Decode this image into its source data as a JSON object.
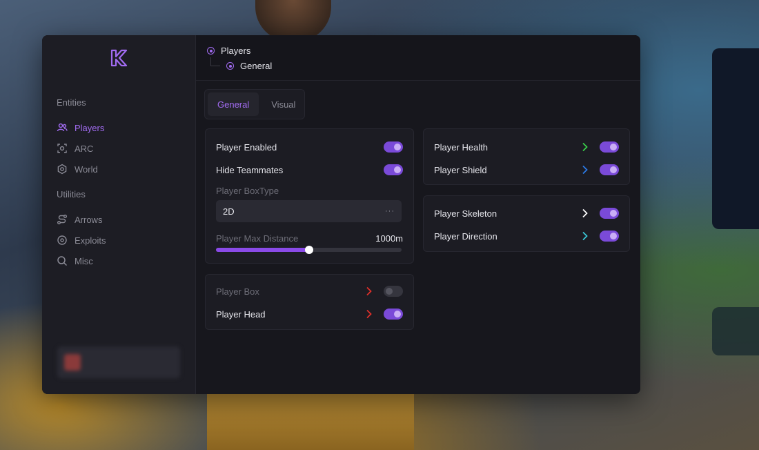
{
  "sidebar": {
    "sections": {
      "entities": "Entities",
      "utilities": "Utilities"
    },
    "items": [
      {
        "label": "Players",
        "icon": "users-icon"
      },
      {
        "label": "ARC",
        "icon": "target-icon"
      },
      {
        "label": "World",
        "icon": "gear-icon"
      },
      {
        "label": "Arrows",
        "icon": "route-icon"
      },
      {
        "label": "Exploits",
        "icon": "crosshair-icon"
      },
      {
        "label": "Misc",
        "icon": "search-icon"
      }
    ],
    "active_item": "Players"
  },
  "breadcrumb": {
    "level1": "Players",
    "level2": "General"
  },
  "tabs": {
    "general": "General",
    "visual": "Visual",
    "active": "General"
  },
  "general_card": {
    "player_enabled": "Player Enabled",
    "hide_teammates": "Hide Teammates",
    "boxtype_label": "Player BoxType",
    "boxtype_value": "2D",
    "boxtype_more": "···",
    "max_distance_label": "Player Max Distance",
    "max_distance_value": "1000m",
    "max_distance_fraction": 0.5
  },
  "box_card": {
    "player_box": "Player Box",
    "player_head": "Player Head"
  },
  "health_card": {
    "player_health": "Player Health",
    "player_shield": "Player Shield"
  },
  "skeleton_card": {
    "player_skeleton": "Player Skeleton",
    "player_direction": "Player Direction"
  },
  "colors": {
    "accent": "#a26cf2",
    "toggle_on": "#7a4ad8",
    "chevron_red": "#e0302a",
    "chevron_green": "#3ad04a",
    "chevron_blue": "#2a7ae8",
    "chevron_white": "#ffffff",
    "chevron_cyan": "#3ac8d8"
  }
}
